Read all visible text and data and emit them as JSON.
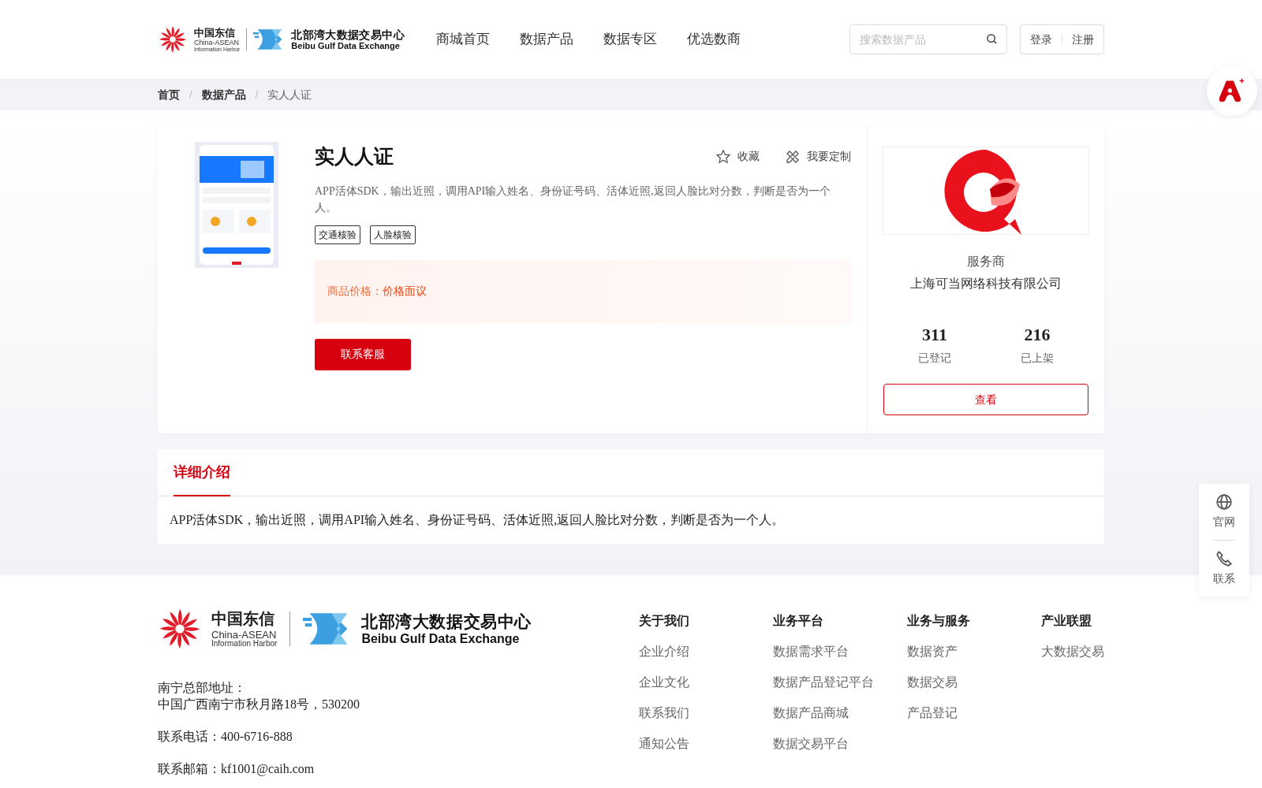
{
  "header": {
    "logo": {
      "cn_name": "中国东信",
      "en_line1": "China-ASEAN",
      "en_line2": "Information Harbor",
      "exchange_cn": "北部湾大数据交易中心",
      "exchange_en": "Beibu Gulf Data Exchange"
    },
    "nav": [
      {
        "label": "商城首页"
      },
      {
        "label": "数据产品"
      },
      {
        "label": "数据专区"
      },
      {
        "label": "优选数商"
      }
    ],
    "search": {
      "placeholder": "搜索数据产品"
    },
    "auth": [
      "登录",
      "注册"
    ]
  },
  "breadcrumb_separator": "/",
  "breadcrumb": [
    {
      "label": "首页",
      "current": false
    },
    {
      "label": "数据产品",
      "current": false
    },
    {
      "label": "实人人证",
      "current": true
    }
  ],
  "product": {
    "image": {
      "kind": "picture"
    },
    "title": "实人人证",
    "actions": [
      {
        "kind": "star",
        "label": "收藏"
      },
      {
        "kind": "custom",
        "label": "我要定制"
      }
    ],
    "description": "APP活体SDK，输出近照，调用API输入姓名、身份证号码、活体近照,返回人脸比对分数，判断是否为一个人。",
    "tags": [
      "交通核验",
      "人脸核验"
    ],
    "price_label": "商品价格：",
    "price_value": "价格面议",
    "contact_button": "联系客服"
  },
  "vendor": {
    "role": "服务商",
    "name": "上海可当网络科技有限公司",
    "stats": [
      {
        "value": "311",
        "label": "已登记"
      },
      {
        "value": "216",
        "label": "已上架"
      }
    ],
    "view_button": "查看"
  },
  "detail": {
    "tabs": [
      {
        "label": "详细介绍",
        "selected": true
      }
    ],
    "text": "APP活体SDK，输出近照，调用API输入姓名、身份证号码、活体近照,返回人脸比对分数，判断是否为一个人。"
  },
  "side_float": [
    {
      "kind": "globe",
      "label": "官网"
    },
    {
      "kind": "phone",
      "label": "联系"
    }
  ],
  "footer": {
    "logo": {
      "cn_name": "中国东信",
      "en_line1": "China-ASEAN",
      "en_line2": "Information Harbor",
      "exchange_cn": "北部湾大数据交易中心",
      "exchange_en": "Beibu Gulf Data Exchange"
    },
    "address_label": "南宁总部地址：",
    "address": "中国广西南宁市秋月路18号，530200",
    "phone": "联系电话：400-6716-888",
    "email": "联系邮箱：kf1001@caih.com",
    "columns": [
      {
        "title": "关于我们",
        "links": [
          "企业介绍",
          "企业文化",
          "联系我们",
          "通知公告"
        ]
      },
      {
        "title": "业务平台",
        "links": [
          "数据需求平台",
          "数据产品登记平台",
          "数据产品商城",
          "数据交易平台"
        ]
      },
      {
        "title": "业务与服务",
        "links": [
          "数据资产",
          "数据交易",
          "产品登记"
        ]
      },
      {
        "title": "产业联盟",
        "links": [
          "大数据交易"
        ]
      }
    ]
  }
}
